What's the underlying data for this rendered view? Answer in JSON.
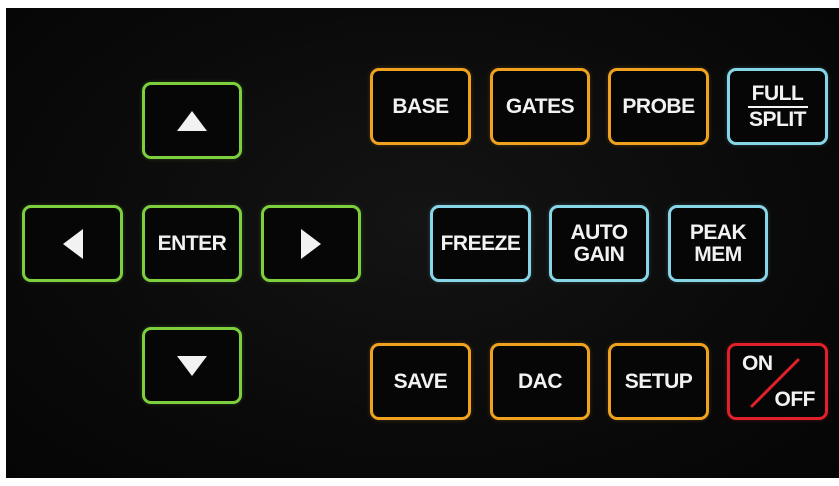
{
  "keypad": {
    "nav": {
      "up_icon": "arrow-up-icon",
      "down_icon": "arrow-down-icon",
      "left_icon": "arrow-left-icon",
      "right_icon": "arrow-right-icon",
      "enter_label": "ENTER"
    },
    "row1": {
      "base_label": "BASE",
      "gates_label": "GATES",
      "probe_label": "PROBE",
      "full_label": "FULL",
      "split_label": "SPLIT"
    },
    "row2": {
      "freeze_label": "FREEZE",
      "auto_label": "AUTO",
      "gain_label": "GAIN",
      "peak_label": "PEAK",
      "mem_label": "MEM"
    },
    "row3": {
      "save_label": "SAVE",
      "dac_label": "DAC",
      "setup_label": "SETUP",
      "on_label": "ON",
      "off_label": "OFF"
    },
    "colors": {
      "nav": "#7ecf3e",
      "function": "#f0a21e",
      "display": "#86d6e8",
      "power": "#e0202a"
    }
  }
}
